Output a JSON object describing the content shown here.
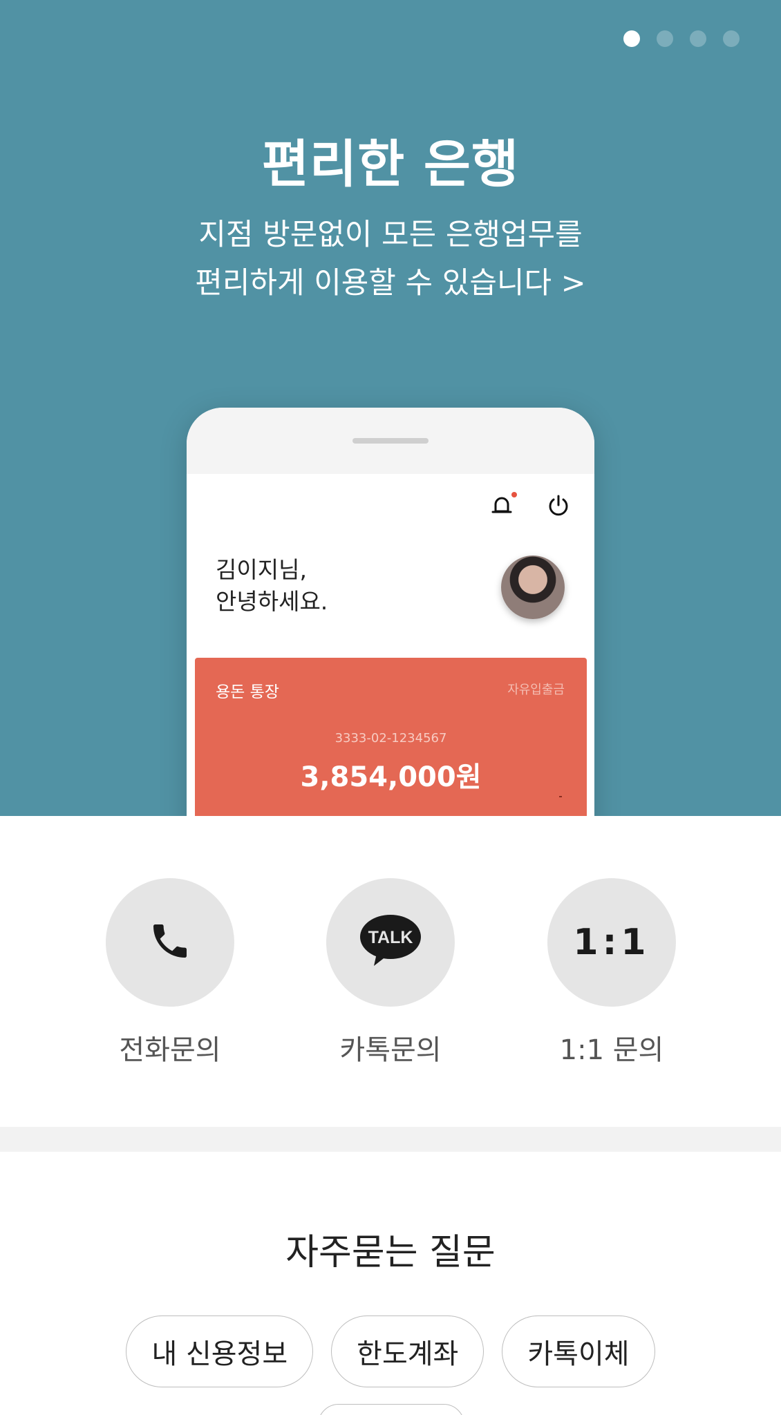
{
  "carousel": {
    "pages": 4,
    "active_index": 0,
    "title": "편리한 은행",
    "subtitle_line1": "지점 방문없이 모든 은행업무를",
    "subtitle_line2": "편리하게 이용할 수 있습니다 >"
  },
  "phone_preview": {
    "greeting_line1": "김이지님,",
    "greeting_line2": "안녕하세요.",
    "account": {
      "name": "용돈 통장",
      "type": "자유입출금",
      "number": "3333-02-1234567",
      "balance": "3,854,000원"
    }
  },
  "contact": {
    "items": [
      {
        "label": "전화문의",
        "icon": "phone-icon"
      },
      {
        "label": "카톡문의",
        "icon": "kakao-talk-icon",
        "icon_text": "TALK"
      },
      {
        "label": "1:1 문의",
        "icon": "one-to-one-icon",
        "icon_text": "1:1"
      }
    ]
  },
  "faq": {
    "title": "자주묻는 질문",
    "chips": [
      "내 신용정보",
      "한도계좌",
      "카톡이체"
    ]
  },
  "colors": {
    "hero_bg": "#5192a4",
    "account_card": "#e46854",
    "circle_bg": "#e5e5e5"
  }
}
